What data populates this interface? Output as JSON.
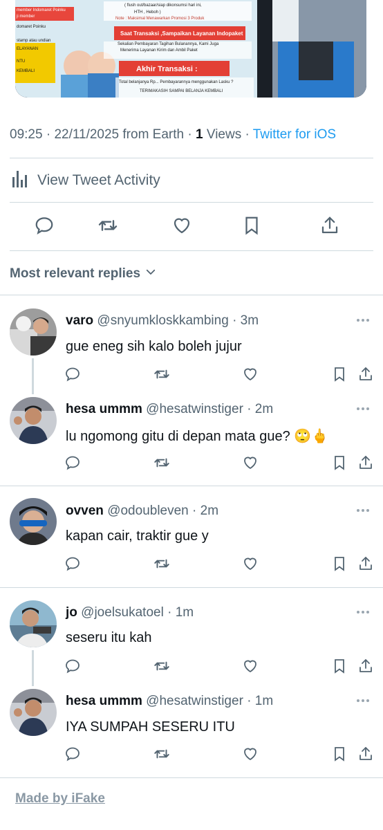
{
  "tweet": {
    "media": {
      "banners": [
        "Saat Transaksi ,Sampaikan Layanan Indopaket",
        "Akhir Transaksi :"
      ],
      "lines": [
        "( flush out/bazaar/siap dikonsumsi hari ini,",
        "HTH , Heboh )",
        "Note : Maksimal Menawarkan Promosi 3 Produk",
        "Sekalian Pembayaran Tagihan Bulanannya, Kami Juga",
        "Menerima Layanan Kirim dan Ambil Paket",
        "Total belanjanya Rp... Pembayarannya menggunakan Lasku ?",
        "TERIMAKASIH SAMPAI BELANJA KEMBALI"
      ],
      "left_labels": [
        "member Indomaret Poinku",
        "ji member",
        "domaret Poinku",
        "stamp atau undian",
        "ELAYANAN",
        "NTU",
        "KEMBALI"
      ]
    },
    "time": "09:25",
    "date": "22/11/2025",
    "location": "from Earth",
    "views_count": "1",
    "views_label": "Views",
    "source": "Twitter for iOS",
    "sep": "·",
    "activity_label": "View Tweet Activity"
  },
  "replies_header": {
    "label": "Most relevant replies"
  },
  "replies": [
    {
      "name": "varo",
      "handle": "@snyumkloskkambing",
      "time": "3m",
      "text": "gue eneg sih kalo boleh jujur"
    },
    {
      "name": "hesa ummm",
      "handle": "@hesatwinstiger",
      "time": "2m",
      "text": "lu ngomong gitu di depan mata gue? 🙄🖕"
    },
    {
      "name": "ovven",
      "handle": "@odoubleven",
      "time": "2m",
      "text": "kapan cair, traktir gue y"
    },
    {
      "name": "jo",
      "handle": "@joelsukatoel",
      "time": "1m",
      "text": "seseru itu kah"
    },
    {
      "name": "hesa ummm",
      "handle": "@hesatwinstiger",
      "time": "1m",
      "text": "IYA SUMPAH SESERU ITU"
    }
  ],
  "footer": {
    "label": "Made by iFake"
  },
  "colors": {
    "link": "#1d9bf0",
    "muted": "#536471",
    "divider": "#cfd9de"
  }
}
